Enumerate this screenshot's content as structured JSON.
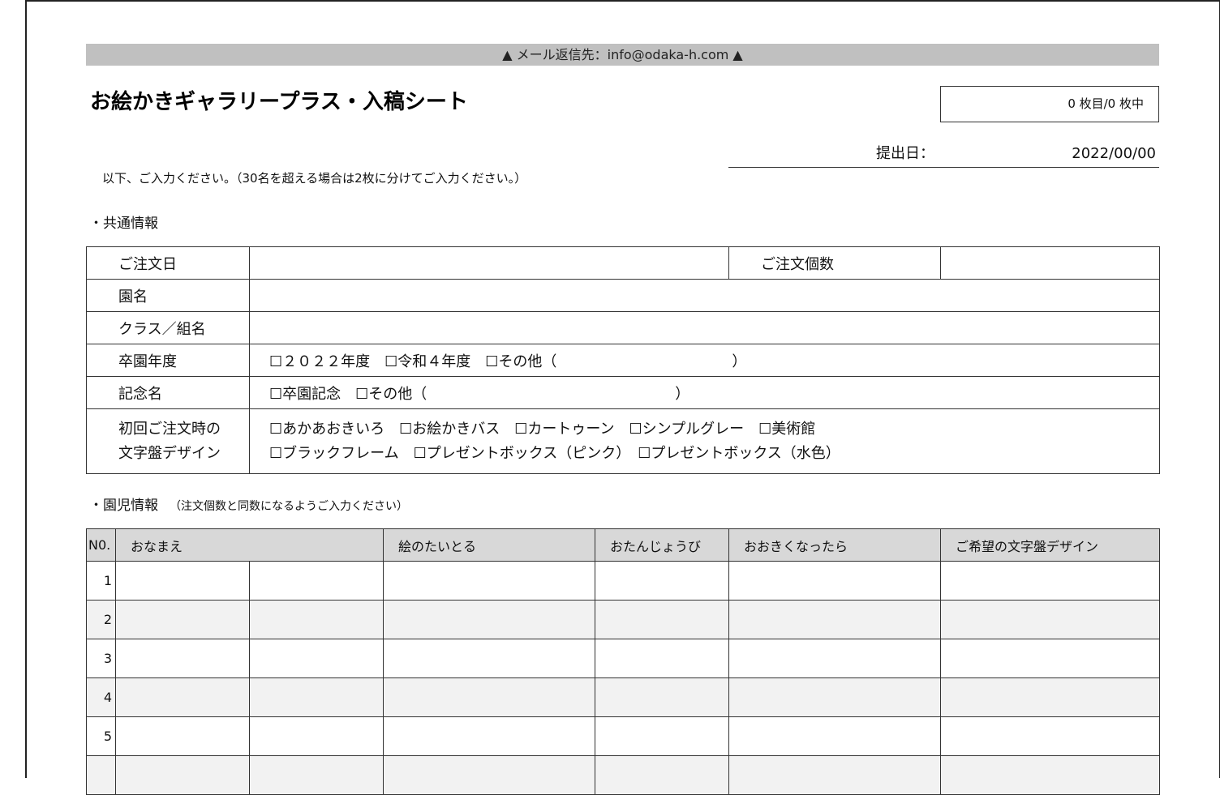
{
  "banner": "▲ メール返信先：info@odaka-h.com ▲",
  "title": "お絵かきギャラリープラス・入稿シート",
  "page_counter": "0 枚目/0 枚中",
  "submission": {
    "label": "提出日：",
    "value": "2022/00/00"
  },
  "instruction": "以下、ご入力ください。（30名を超える場合は2枚に分けてご入力ください。）",
  "common_section": {
    "title": "・共通情報"
  },
  "common_table": {
    "order_date_label": "ご注文日",
    "order_count_label": "ご注文個数",
    "school_name_label": "園名",
    "class_label": "クラス／組名",
    "grad_year_label": "卒園年度",
    "grad_year_options": "☐２０２２年度　☐令和４年度　☐その他（　　　　　　　　　　　　）",
    "memorial_label": "記念名",
    "memorial_options": "☐卒園記念　☐その他（　　　　　　　　　　　　　　　　　）",
    "design_label_line1": "初回ご注文時の",
    "design_label_line2": "文字盤デザイン",
    "design_options_line1": "☐あかあおきいろ　☐お絵かきバス　☐カートゥーン　☐シンプルグレー　☐美術館",
    "design_options_line2": "☐ブラックフレーム　☐プレゼントボックス（ピンク）　☐プレゼントボックス（水色）"
  },
  "kids_section": {
    "title": "・園児情報",
    "note": "（注文個数と同数になるようご入力ください）"
  },
  "kids_table": {
    "headers": {
      "no": "N0.",
      "name": "おなまえ",
      "title": "絵のたいとる",
      "birthday": "おたんじょうび",
      "dream": "おおきくなったら",
      "design": "ご希望の文字盤デザイン"
    },
    "rows": [
      {
        "no": "1"
      },
      {
        "no": "2"
      },
      {
        "no": "3"
      },
      {
        "no": "4"
      },
      {
        "no": "5"
      }
    ]
  }
}
